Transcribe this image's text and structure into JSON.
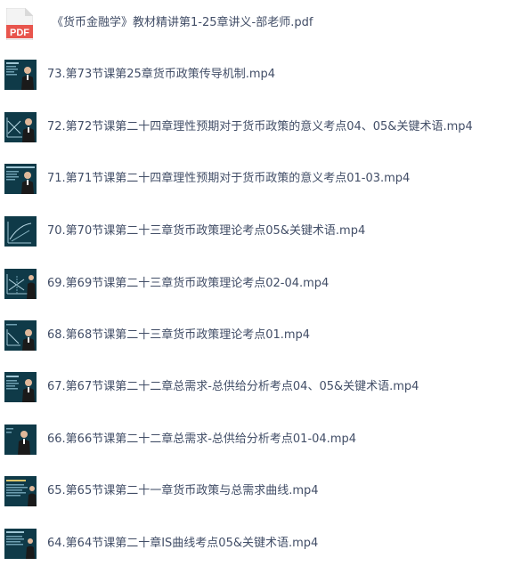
{
  "files": [
    {
      "name": "《货币金融学》教材精讲第1-25章讲义-部老师.pdf",
      "type": "pdf",
      "icon": "pdf-icon"
    },
    {
      "name": "73.第73节课第25章货币政策传导机制.mp4",
      "type": "video",
      "icon": "video-thumbnail"
    },
    {
      "name": "72.第72节课第二十四章理性预期对于货币政策的意义考点04、05&关键术语.mp4",
      "type": "video",
      "icon": "video-thumbnail"
    },
    {
      "name": "71.第71节课第二十四章理性预期对于货币政策的意义考点01-03.mp4",
      "type": "video",
      "icon": "video-thumbnail"
    },
    {
      "name": "70.第70节课第二十三章货币政策理论考点05&关键术语.mp4",
      "type": "video",
      "icon": "video-thumbnail"
    },
    {
      "name": "69.第69节课第二十三章货币政策理论考点02-04.mp4",
      "type": "video",
      "icon": "video-thumbnail"
    },
    {
      "name": "68.第68节课第二十三章货币政策理论考点01.mp4",
      "type": "video",
      "icon": "video-thumbnail"
    },
    {
      "name": "67.第67节课第二十二章总需求-总供给分析考点04、05&关键术语.mp4",
      "type": "video",
      "icon": "video-thumbnail"
    },
    {
      "name": "66.第66节课第二十二章总需求-总供给分析考点01-04.mp4",
      "type": "video",
      "icon": "video-thumbnail"
    },
    {
      "name": "65.第65节课第二十一章货币政策与总需求曲线.mp4",
      "type": "video",
      "icon": "video-thumbnail"
    },
    {
      "name": "64.第64节课第二十章IS曲线考点05&关键术语.mp4",
      "type": "video",
      "icon": "video-thumbnail"
    }
  ],
  "colors": {
    "text": "#424e67",
    "pdf_red": "#e8554d",
    "pdf_page": "#f3f3f3",
    "thumb_bg": "#0f3a48"
  },
  "pdf_badge": "PDF"
}
